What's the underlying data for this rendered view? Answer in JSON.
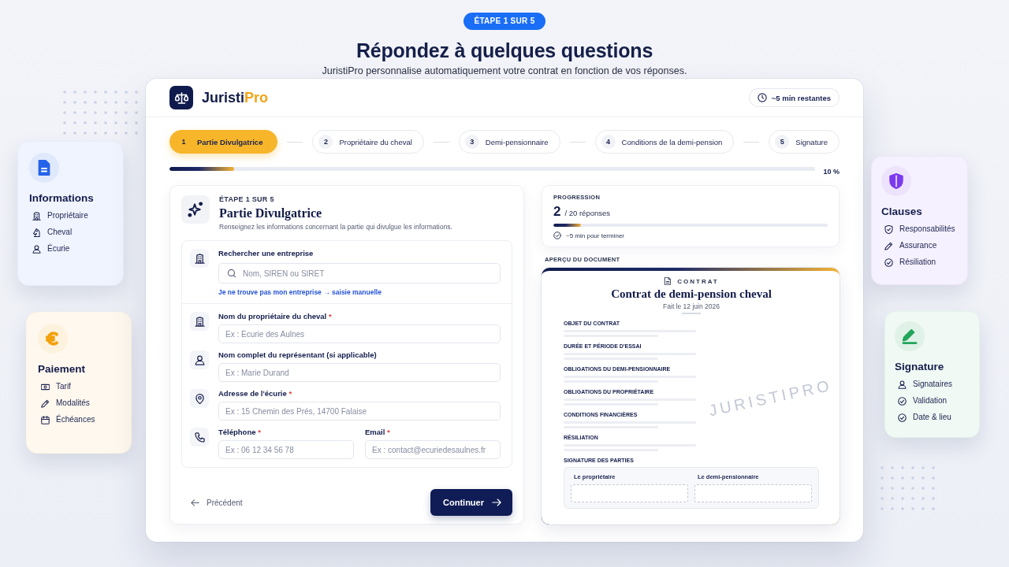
{
  "badge": "ÉTAPE 1 SUR 5",
  "title": "Répondez à quelques questions",
  "subtitle": "JuristiPro personnalise automatiquement votre contrat en fonction de vos réponses.",
  "side_cards": [
    {
      "title": "Informations",
      "color": "#2563eb",
      "items": [
        "Propriétaire",
        "Cheval",
        "Écurie"
      ]
    },
    {
      "title": "Paiement",
      "color": "#f2a20c",
      "items": [
        "Tarif",
        "Modalités",
        "Échéances"
      ]
    },
    {
      "title": "Clauses",
      "color": "#7c3aed",
      "items": [
        "Responsabilités",
        "Assurance",
        "Résiliation"
      ]
    },
    {
      "title": "Signature",
      "color": "#22a55b",
      "items": [
        "Signataires",
        "Validation",
        "Date & lieu"
      ]
    }
  ],
  "app": {
    "brand": {
      "name": "Juristi",
      "name_accent": "Pro"
    },
    "time_left": "~5 min restantes",
    "steps": [
      {
        "number": "1",
        "label": "Partie Divulgatrice",
        "selected": true
      },
      {
        "number": "2",
        "label": "Propriétaire du cheval",
        "selected": false
      },
      {
        "number": "3",
        "label": "Demi-pensionnaire",
        "selected": false
      },
      {
        "number": "4",
        "label": "Conditions de la demi-pension",
        "selected": false
      },
      {
        "number": "5",
        "label": "Signature",
        "selected": false
      }
    ],
    "progress": {
      "level": 0.1,
      "reading": "10 %"
    },
    "form": {
      "step_label": "ÉTAPE 1 SUR 5",
      "title": "Partie Divulgatrice",
      "description": "Renseignez les informations concernant la partie qui divulgue les informations.",
      "search": {
        "label": "Rechercher une entreprise",
        "placeholder": "Nom, SIREN ou SIRET",
        "link": "Je ne trouve pas mon entreprise → saisie manuelle"
      },
      "fields": [
        {
          "inputs": [
            {
              "label": "Nom du propriétaire du cheval",
              "required_mark": "*",
              "placeholder": "Ex : Écurie des Aulnes"
            }
          ]
        },
        {
          "inputs": [
            {
              "label": "Nom complet du représentant (si applicable)",
              "placeholder": "Ex : Marie Durand"
            }
          ]
        },
        {
          "inputs": [
            {
              "label": "Adresse de l'écurie",
              "required_mark": "*",
              "placeholder": "Ex : 15 Chemin des Prés, 14700 Falaise"
            }
          ]
        },
        {
          "inputs": [
            {
              "label": "Téléphone",
              "required_mark": "*",
              "placeholder": "Ex : 06 12 34 56 78"
            },
            {
              "label": "Email",
              "required_mark": "*",
              "placeholder": "Ex : contact@ecuriedesaulnes.fr"
            }
          ]
        }
      ],
      "back_button": "Précédent",
      "next_button": "Continuer"
    },
    "progression": {
      "label": "PROGRESSION",
      "count": "2",
      "total": "/ 20 réponses",
      "level": 0.1,
      "note": "~5 min pour terminer"
    },
    "preview": {
      "label": "APERÇU DU DOCUMENT",
      "document": {
        "kicker": "CONTRAT",
        "title": "Contrat de demi-pension cheval",
        "date": "Fait le 12 juin 2026",
        "watermark": "JURISTIPRO",
        "sections": [
          {
            "heading": "OBJET DU CONTRAT"
          },
          {
            "heading": "DURÉE ET PÉRIODE D'ESSAI"
          },
          {
            "heading": "OBLIGATIONS DU DEMI-PENSIONNAIRE"
          },
          {
            "heading": "OBLIGATIONS DU PROPRIÉTAIRE"
          },
          {
            "heading": "CONDITIONS FINANCIÈRES"
          },
          {
            "heading": "RÉSILIATION"
          }
        ],
        "signature": {
          "heading": "SIGNATURE DES PARTIES",
          "parties": [
            "Le propriétaire",
            "Le demi-pensionnaire"
          ]
        }
      }
    }
  }
}
